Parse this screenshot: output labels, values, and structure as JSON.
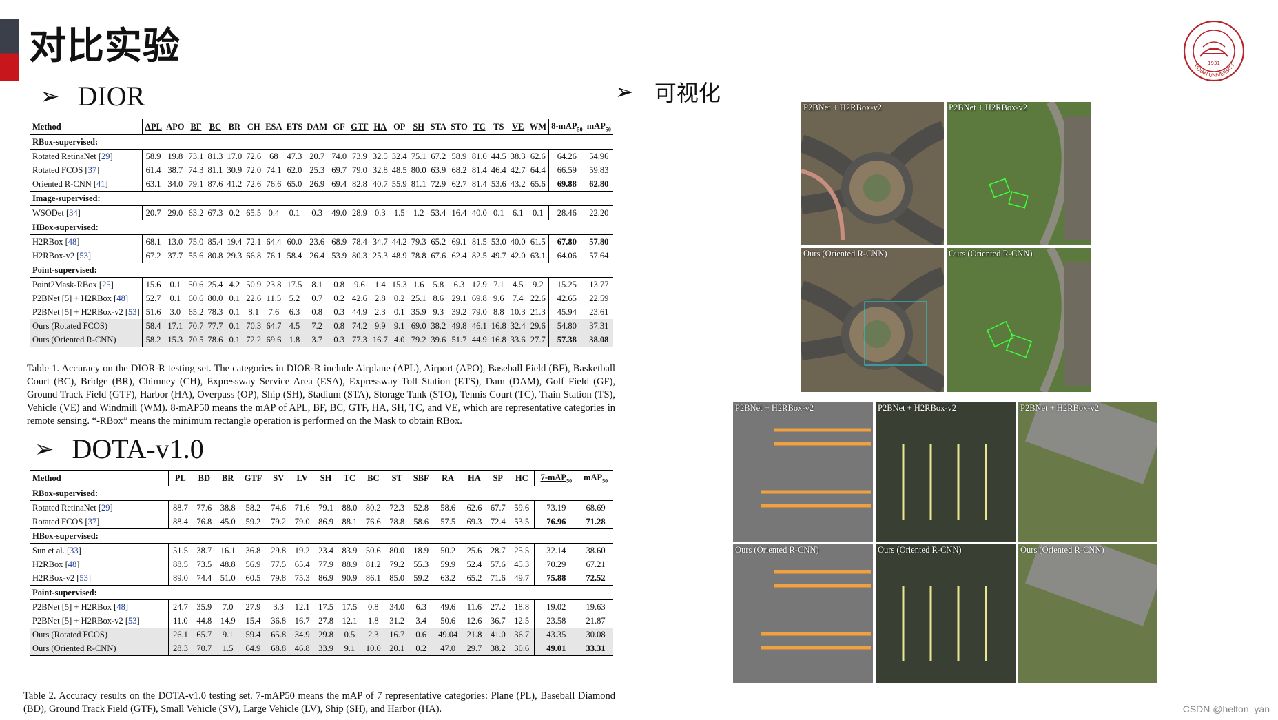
{
  "slide": {
    "title": "对比实验",
    "section_dior": "DIOR",
    "section_dota": "DOTA-v1.0",
    "section_viz": "可视化",
    "bullet": "➢",
    "watermark": "CSDN @helton_yan"
  },
  "table1": {
    "headers": [
      "Method",
      "APL",
      "APO",
      "BF",
      "BC",
      "BR",
      "CH",
      "ESA",
      "ETS",
      "DAM",
      "GF",
      "GTF",
      "HA",
      "OP",
      "SH",
      "STA",
      "STO",
      "TC",
      "TS",
      "VE",
      "WM",
      "8-mAP50",
      "mAP50"
    ],
    "groups": [
      {
        "name": "RBox-supervised:",
        "rows": [
          {
            "method": "Rotated RetinaNet",
            "ref": "29",
            "vals": [
              "58.9",
              "19.8",
              "73.1",
              "81.3",
              "17.0",
              "72.6",
              "68",
              "47.3",
              "20.7",
              "74.0",
              "73.9",
              "32.5",
              "32.4",
              "75.1",
              "67.2",
              "58.9",
              "81.0",
              "44.5",
              "38.3",
              "62.6",
              "64.26",
              "54.96"
            ]
          },
          {
            "method": "Rotated FCOS",
            "ref": "37",
            "vals": [
              "61.4",
              "38.7",
              "74.3",
              "81.1",
              "30.9",
              "72.0",
              "74.1",
              "62.0",
              "25.3",
              "69.7",
              "79.0",
              "32.8",
              "48.5",
              "80.0",
              "63.9",
              "68.2",
              "81.4",
              "46.4",
              "42.7",
              "64.4",
              "66.59",
              "59.83"
            ]
          },
          {
            "method": "Oriented R-CNN",
            "ref": "41",
            "vals": [
              "63.1",
              "34.0",
              "79.1",
              "87.6",
              "41.2",
              "72.6",
              "76.6",
              "65.0",
              "26.9",
              "69.4",
              "82.8",
              "40.7",
              "55.9",
              "81.1",
              "72.9",
              "62.7",
              "81.4",
              "53.6",
              "43.2",
              "65.6",
              "69.88",
              "62.80"
            ],
            "bold": [
              20,
              21
            ]
          }
        ]
      },
      {
        "name": "Image-supervised:",
        "rows": [
          {
            "method": "WSODet",
            "ref": "34",
            "vals": [
              "20.7",
              "29.0",
              "63.2",
              "67.3",
              "0.2",
              "65.5",
              "0.4",
              "0.1",
              "0.3",
              "49.0",
              "28.9",
              "0.3",
              "1.5",
              "1.2",
              "53.4",
              "16.4",
              "40.0",
              "0.1",
              "6.1",
              "0.1",
              "28.46",
              "22.20"
            ]
          }
        ]
      },
      {
        "name": "HBox-supervised:",
        "rows": [
          {
            "method": "H2RBox",
            "ref": "48",
            "vals": [
              "68.1",
              "13.0",
              "75.0",
              "85.4",
              "19.4",
              "72.1",
              "64.4",
              "60.0",
              "23.6",
              "68.9",
              "78.4",
              "34.7",
              "44.2",
              "79.3",
              "65.2",
              "69.1",
              "81.5",
              "53.0",
              "40.0",
              "61.5",
              "67.80",
              "57.80"
            ],
            "bold": [
              20,
              21
            ]
          },
          {
            "method": "H2RBox-v2",
            "ref": "53",
            "vals": [
              "67.2",
              "37.7",
              "55.6",
              "80.8",
              "29.3",
              "66.8",
              "76.1",
              "58.4",
              "26.4",
              "53.9",
              "80.3",
              "25.3",
              "48.9",
              "78.8",
              "67.6",
              "62.4",
              "82.5",
              "49.7",
              "42.0",
              "63.1",
              "64.06",
              "57.64"
            ]
          }
        ]
      },
      {
        "name": "Point-supervised:",
        "rows": [
          {
            "method": "Point2Mask-RBox",
            "ref": "25",
            "vals": [
              "15.6",
              "0.1",
              "50.6",
              "25.4",
              "4.2",
              "50.9",
              "23.8",
              "17.5",
              "8.1",
              "0.8",
              "9.6",
              "1.4",
              "15.3",
              "1.6",
              "5.8",
              "6.3",
              "17.9",
              "7.1",
              "4.5",
              "9.2",
              "15.25",
              "13.77"
            ]
          },
          {
            "method": "P2BNet [5] + H2RBox",
            "ref": "48",
            "vals": [
              "52.7",
              "0.1",
              "60.6",
              "80.0",
              "0.1",
              "22.6",
              "11.5",
              "5.2",
              "0.7",
              "0.2",
              "42.6",
              "2.8",
              "0.2",
              "25.1",
              "8.6",
              "29.1",
              "69.8",
              "9.6",
              "7.4",
              "22.6",
              "42.65",
              "22.59"
            ]
          },
          {
            "method": "P2BNet [5] + H2RBox-v2",
            "ref": "53",
            "vals": [
              "51.6",
              "3.0",
              "65.2",
              "78.3",
              "0.1",
              "8.1",
              "7.6",
              "6.3",
              "0.8",
              "0.3",
              "44.9",
              "2.3",
              "0.1",
              "35.9",
              "9.3",
              "39.2",
              "79.0",
              "8.8",
              "10.3",
              "21.3",
              "45.94",
              "23.61"
            ]
          },
          {
            "method": "Ours (Rotated FCOS)",
            "ref": "",
            "shade": true,
            "vals": [
              "58.4",
              "17.1",
              "70.7",
              "77.7",
              "0.1",
              "70.3",
              "64.7",
              "4.5",
              "7.2",
              "0.8",
              "74.2",
              "9.9",
              "9.1",
              "69.0",
              "38.2",
              "49.8",
              "46.1",
              "16.8",
              "32.4",
              "29.6",
              "54.80",
              "37.31"
            ]
          },
          {
            "method": "Ours (Oriented R-CNN)",
            "ref": "",
            "shade": true,
            "vals": [
              "58.2",
              "15.3",
              "70.5",
              "78.6",
              "0.1",
              "72.2",
              "69.6",
              "1.8",
              "3.7",
              "0.3",
              "77.3",
              "16.7",
              "4.0",
              "79.2",
              "39.6",
              "51.7",
              "44.9",
              "16.8",
              "33.6",
              "27.7",
              "57.38",
              "38.08"
            ],
            "bold": [
              20,
              21
            ]
          }
        ]
      }
    ],
    "caption": "Table 1. Accuracy on the DIOR-R testing set. The categories in DIOR-R include Airplane (APL), Airport (APO), Baseball Field (BF), Basketball Court (BC), Bridge (BR), Chimney (CH), Expressway Service Area (ESA), Expressway Toll Station (ETS), Dam (DAM), Golf Field (GF), Ground Track Field (GTF), Harbor (HA), Overpass (OP), Ship (SH), Stadium (STA), Storage Tank (STO), Tennis Court (TC), Train Station (TS), Vehicle (VE) and Windmill (WM). 8-mAP50 means the mAP of APL, BF, BC, GTF, HA, SH, TC, and VE, which are representative categories in remote sensing. “-RBox” means the minimum rectangle operation is performed on the Mask to obtain RBox."
  },
  "table2": {
    "headers": [
      "Method",
      "PL",
      "BD",
      "BR",
      "GTF",
      "SV",
      "LV",
      "SH",
      "TC",
      "BC",
      "ST",
      "SBF",
      "RA",
      "HA",
      "SP",
      "HC",
      "7-mAP50",
      "mAP50"
    ],
    "groups": [
      {
        "name": "RBox-supervised:",
        "rows": [
          {
            "method": "Rotated RetinaNet",
            "ref": "29",
            "vals": [
              "88.7",
              "77.6",
              "38.8",
              "58.2",
              "74.6",
              "71.6",
              "79.1",
              "88.0",
              "80.2",
              "72.3",
              "52.8",
              "58.6",
              "62.6",
              "67.7",
              "59.6",
              "73.19",
              "68.69"
            ]
          },
          {
            "method": "Rotated FCOS",
            "ref": "37",
            "vals": [
              "88.4",
              "76.8",
              "45.0",
              "59.2",
              "79.2",
              "79.0",
              "86.9",
              "88.1",
              "76.6",
              "78.8",
              "58.6",
              "57.5",
              "69.3",
              "72.4",
              "53.5",
              "76.96",
              "71.28"
            ],
            "bold": [
              15,
              16
            ]
          }
        ]
      },
      {
        "name": "HBox-supervised:",
        "rows": [
          {
            "method": "Sun et al.",
            "ref": "33",
            "vals": [
              "51.5",
              "38.7",
              "16.1",
              "36.8",
              "29.8",
              "19.2",
              "23.4",
              "83.9",
              "50.6",
              "80.0",
              "18.9",
              "50.2",
              "25.6",
              "28.7",
              "25.5",
              "32.14",
              "38.60"
            ]
          },
          {
            "method": "H2RBox",
            "ref": "48",
            "vals": [
              "88.5",
              "73.5",
              "48.8",
              "56.9",
              "77.5",
              "65.4",
              "77.9",
              "88.9",
              "81.2",
              "79.2",
              "55.3",
              "59.9",
              "52.4",
              "57.6",
              "45.3",
              "70.29",
              "67.21"
            ]
          },
          {
            "method": "H2RBox-v2",
            "ref": "53",
            "vals": [
              "89.0",
              "74.4",
              "51.0",
              "60.5",
              "79.8",
              "75.3",
              "86.9",
              "90.9",
              "86.1",
              "85.0",
              "59.2",
              "63.2",
              "65.2",
              "71.6",
              "49.7",
              "75.88",
              "72.52"
            ],
            "bold": [
              15,
              16
            ]
          }
        ]
      },
      {
        "name": "Point-supervised:",
        "rows": [
          {
            "method": "P2BNet [5] + H2RBox",
            "ref": "48",
            "vals": [
              "24.7",
              "35.9",
              "7.0",
              "27.9",
              "3.3",
              "12.1",
              "17.5",
              "17.5",
              "0.8",
              "34.0",
              "6.3",
              "49.6",
              "11.6",
              "27.2",
              "18.8",
              "19.02",
              "19.63"
            ]
          },
          {
            "method": "P2BNet [5] + H2RBox-v2",
            "ref": "53",
            "vals": [
              "11.0",
              "44.8",
              "14.9",
              "15.4",
              "36.8",
              "16.7",
              "27.8",
              "12.1",
              "1.8",
              "31.2",
              "3.4",
              "50.6",
              "12.6",
              "36.7",
              "12.5",
              "23.58",
              "21.87"
            ]
          },
          {
            "method": "Ours (Rotated FCOS)",
            "ref": "",
            "shade": true,
            "vals": [
              "26.1",
              "65.7",
              "9.1",
              "59.4",
              "65.8",
              "34.9",
              "29.8",
              "0.5",
              "2.3",
              "16.7",
              "0.6",
              "49.04",
              "21.8",
              "41.0",
              "36.7",
              "43.35",
              "30.08"
            ]
          },
          {
            "method": "Ours (Oriented R-CNN)",
            "ref": "",
            "shade": true,
            "vals": [
              "28.3",
              "70.7",
              "1.5",
              "64.9",
              "68.8",
              "46.8",
              "33.9",
              "9.1",
              "10.0",
              "20.1",
              "0.2",
              "47.0",
              "29.7",
              "38.2",
              "30.6",
              "49.01",
              "33.31"
            ],
            "bold": [
              15,
              16
            ]
          }
        ]
      }
    ],
    "caption": "Table 2. Accuracy results on the DOTA-v1.0 testing set. 7-mAP50 means the mAP of 7 representative categories: Plane (PL), Baseball Diamond (BD), Ground Track Field (GTF), Small Vehicle (SV), Large Vehicle (LV), Ship (SH), and Harbor (HA)."
  },
  "viz": {
    "top_labels": [
      "P2BNet + H2RBox-v2",
      "P2BNet + H2RBox-v2",
      "Ours (Oriented R-CNN)",
      "Ours (Oriented R-CNN)"
    ],
    "bottom_labels": [
      "P2BNet + H2RBox-v2",
      "P2BNet + H2RBox-v2",
      "P2BNet + H2RBox-v2",
      "Ours (Oriented R-CNN)",
      "Ours (Oriented R-CNN)",
      "Ours (Oriented R-CNN)"
    ]
  },
  "logo": {
    "text": "XIDIAN UNIVERSITY",
    "year": "1931"
  }
}
